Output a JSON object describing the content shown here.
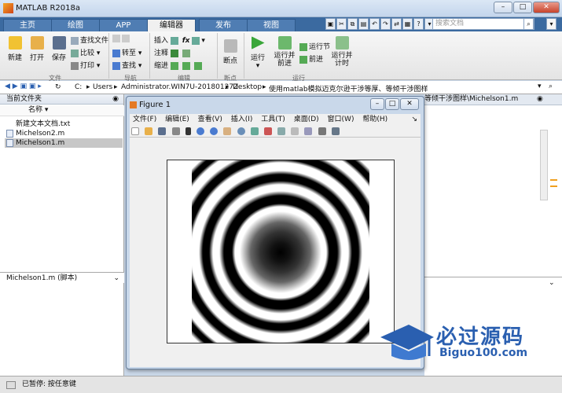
{
  "window": {
    "title": "MATLAB R2018a"
  },
  "tabs": [
    "主页",
    "绘图",
    "APP",
    "编辑器",
    "发布",
    "视图"
  ],
  "search": {
    "placeholder": "搜索文档"
  },
  "ribbon": {
    "file": {
      "new": "新建",
      "open": "打开",
      "save": "保存",
      "find_files": "查找文件",
      "compare": "比较",
      "print": "打印",
      "group": "文件"
    },
    "nav": {
      "goto": "转至",
      "find": "查找",
      "group": "导航"
    },
    "edit": {
      "insert": "插入",
      "comment": "注释",
      "indent": "缩进",
      "fx": "fx",
      "group": "编辑"
    },
    "breakpoint": {
      "label": "断点",
      "group": "断点"
    },
    "run": {
      "run": "运行",
      "run_advance": "运行并\n前进",
      "run_section": "运行节",
      "advance": "前进",
      "run_time": "运行并\n计时",
      "group": "运行"
    }
  },
  "address": {
    "parts": [
      "C:",
      "Users",
      "Administrator.WIN7U-20180127Z",
      "Desktop",
      "使用matlab模拟迈克尔逊干涉等厚、等倾干涉图样"
    ]
  },
  "current_folder": {
    "title": "当前文件夹",
    "col_name": "名称",
    "files": [
      "新建文本文档.txt",
      "Michelson2.m",
      "Michelson1.m"
    ]
  },
  "detail": {
    "title": "Michelson1.m  (脚本)"
  },
  "editor": {
    "tabs_text": "等倾干涉图样\\Michelson1.m"
  },
  "status": {
    "text": "已暂停: 按任意键"
  },
  "figure": {
    "title": "Figure 1",
    "menu": [
      "文件(F)",
      "编辑(E)",
      "查看(V)",
      "插入(I)",
      "工具(T)",
      "桌面(D)",
      "窗口(W)",
      "帮助(H)"
    ]
  },
  "watermark": {
    "title": "必过源码",
    "url": "Biguo100.com"
  },
  "colors": {
    "tabbar": "#3b6aa0",
    "accent": "#2a5fb0"
  }
}
